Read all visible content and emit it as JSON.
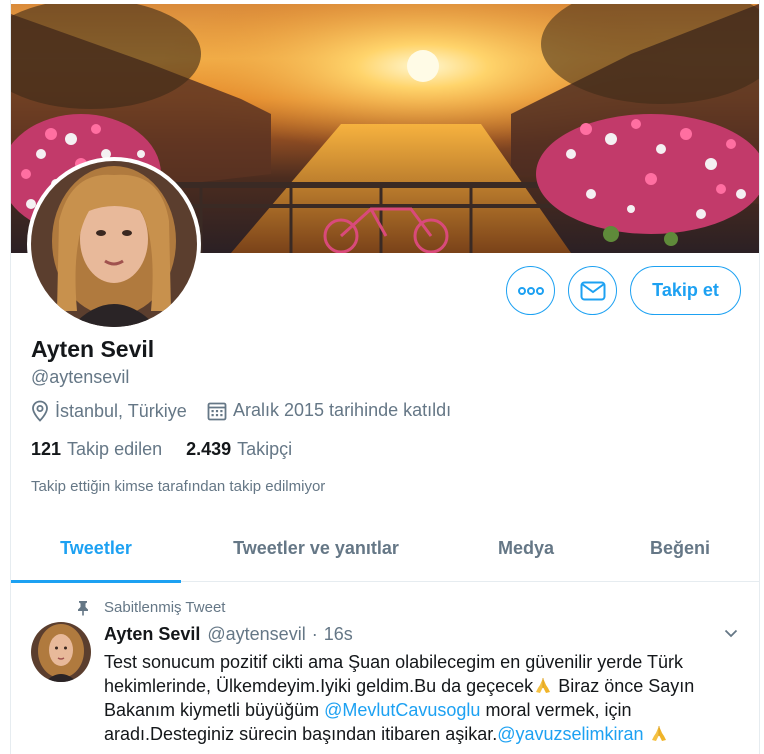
{
  "profile": {
    "name": "Ayten Sevil",
    "handle": "@aytensevil",
    "location": "İstanbul, Türkiye",
    "joined": "Aralık 2015 tarihinde katıldı",
    "following_count": "121",
    "following_label": "Takip edilen",
    "followers_count": "2.439",
    "followers_label": "Takipçi",
    "notice": "Takip ettiğin kimse tarafından takip edilmiyor"
  },
  "actions": {
    "more_icon": "more-icon",
    "dm_icon": "envelope-icon",
    "follow_label": "Takip et"
  },
  "tabs": [
    {
      "label": "Tweetler",
      "active": true
    },
    {
      "label": "Tweetler ve yanıtlar",
      "active": false
    },
    {
      "label": "Medya",
      "active": false
    },
    {
      "label": "Beğeni",
      "active": false
    }
  ],
  "tweet": {
    "pinned_label": "Sabitlenmiş Tweet",
    "author_name": "Ayten Sevil",
    "author_handle": "@aytensevil",
    "separator": "·",
    "time": "16s",
    "text_1": "Test sonucum pozitif cikti ama  Şuan olabilecegim en güvenilir yerde Türk hekimlerinde, Ülkemdeyim.Iyiki geldim.Bu da geçecek",
    "text_2": " Biraz önce Sayın Bakanım kiymetli büyüğüm ",
    "mention_1": "@MevlutCavusoglu",
    "text_3": " moral vermek, için aradı.Desteginiz sürecin başından itibaren aşikar.",
    "mention_2": "@yavuzselimkiran",
    "emoji": "folded-hands"
  },
  "colors": {
    "accent": "#1da1f2",
    "secondary_text": "#657786",
    "primary_text": "#14171a",
    "border": "#e6ecf0"
  }
}
